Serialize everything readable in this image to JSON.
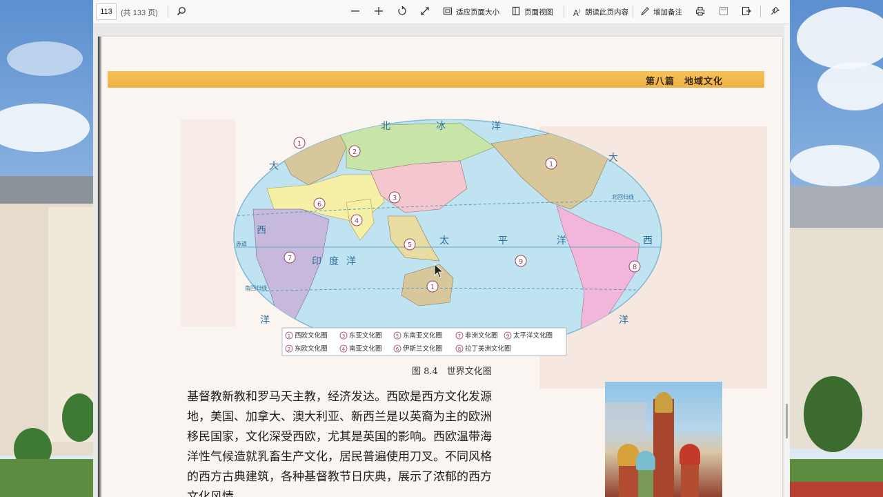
{
  "toolbar": {
    "page_number": "113",
    "page_total": "(共 133 页)",
    "fit_page": "适应页面大小",
    "page_view": "页面视图",
    "read_aloud": "朗读此页内容",
    "add_note": "增加备注"
  },
  "document": {
    "header": "第八篇　地域文化",
    "figure_caption": "图 8.4　世界文化圈",
    "map": {
      "ocean_labels": [
        "北",
        "冰",
        "洋",
        "大",
        "西",
        "大",
        "太",
        "平",
        "洋",
        "西",
        "印",
        "度",
        "洋",
        "洋",
        "洋"
      ],
      "line_labels": [
        "赤道",
        "北回归线",
        "南回归线"
      ],
      "region_numbers": [
        "1",
        "2",
        "3",
        "4",
        "5",
        "6",
        "7",
        "8",
        "9",
        "1",
        "1"
      ],
      "legend": [
        {
          "num": "1",
          "label": "西欧文化圈"
        },
        {
          "num": "3",
          "label": "东亚文化圈"
        },
        {
          "num": "5",
          "label": "东南亚文化圈"
        },
        {
          "num": "7",
          "label": "非洲文化圈"
        },
        {
          "num": "9",
          "label": "太平洋文化圈"
        },
        {
          "num": "2",
          "label": "东欧文化圈"
        },
        {
          "num": "4",
          "label": "南亚文化圈"
        },
        {
          "num": "6",
          "label": "伊斯兰文化圈"
        },
        {
          "num": "8",
          "label": "拉丁美洲文化圈"
        }
      ]
    },
    "body_lines": [
      "基督教新教和罗马天主教，经济发达。西欧是西方文化发源",
      "地，美国、加拿大、澳大利亚、新西兰是以英裔为主的欧洲",
      "移民国家，文化深受西欧，尤其是英国的影响。西欧温带海",
      "洋性气候造就乳畜生产文化，居民普遍使用刀叉。不同风格",
      "的西方古典建筑，各种基督教节日庆典，展示了浓郁的西方",
      "文化风情。"
    ]
  },
  "colors": {
    "banner": "#f0b446",
    "ocean": "#bfe3f0",
    "western_europe": "#d8c79a",
    "east_europe": "#c9e4a8",
    "east_asia": "#f4c6cd",
    "islamic": "#f6efa6",
    "africa": "#c6b9dc",
    "latin_america": "#f1b6da"
  }
}
